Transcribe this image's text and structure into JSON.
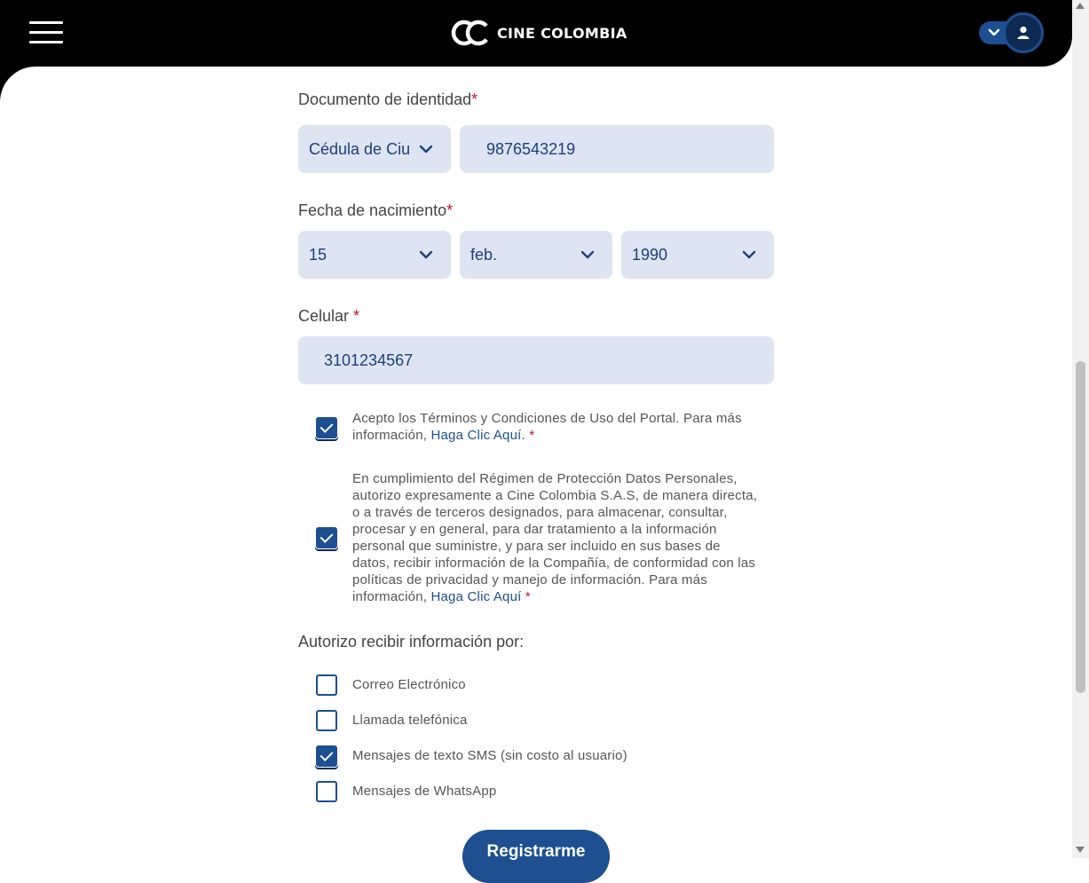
{
  "header": {
    "brand": "CINE COLOMBIA",
    "menu_icon": "hamburger-menu-icon",
    "user_icon": "user-icon"
  },
  "form": {
    "documento": {
      "label": "Documento de identidad",
      "required_mark": "*",
      "type_value": "Cédula de Ciudadanía",
      "number_value": "9876543219"
    },
    "fecha": {
      "label": "Fecha de nacimiento",
      "required_mark": "*",
      "day": "15",
      "month": "feb.",
      "year": "1990"
    },
    "celular": {
      "label": "Celular ",
      "required_mark": "*",
      "value": "3101234567"
    },
    "terms": {
      "checked": true,
      "text": "Acepto los Términos y Condiciones de Uso del Portal. Para más información, ",
      "link": "Haga Clic Aquí",
      "after": ".",
      "required_mark": "*"
    },
    "privacy": {
      "checked": true,
      "text": "En cumplimiento del Régimen de Protección Datos Personales, autorizo expresamente a Cine Colombia S.A.S, de manera directa, o a través de terceros designados, para almacenar, consultar, procesar y en general, para dar tratamiento a la información personal que suministre, y para ser incluido en sus bases de datos, recibir información de la Compañía, de conformidad con las políticas de privacidad y manejo de información. Para más información, ",
      "link": "Haga Clic Aquí",
      "required_mark": "*"
    },
    "autorizo_label": "Autorizo recibir información por:",
    "channels": [
      {
        "label": "Correo Electrónico",
        "checked": false
      },
      {
        "label": "Llamada telefónica",
        "checked": false
      },
      {
        "label": "Mensajes de texto SMS (sin costo al usuario)",
        "checked": true
      },
      {
        "label": "Mensajes de WhatsApp",
        "checked": false
      }
    ],
    "submit_label": "Registrarme"
  },
  "colors": {
    "primary": "#1d4f91",
    "field_bg": "#dde4f2",
    "required": "#c0102b",
    "header_bg": "#000000"
  }
}
